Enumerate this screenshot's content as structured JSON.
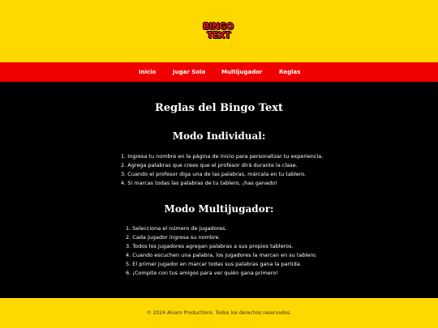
{
  "header": {
    "logo_line1": "BINGO",
    "logo_line2": "TEXT"
  },
  "nav": {
    "items": [
      {
        "label": "Inicio"
      },
      {
        "label": "Jugar Solo"
      },
      {
        "label": "Multijugador"
      },
      {
        "label": "Reglas"
      }
    ]
  },
  "main": {
    "title": "Reglas del Bingo Text",
    "individual": {
      "title": "Modo Individual:",
      "rules": [
        "Ingresa tu nombre en la página de inicio para personalizar tu experiencia.",
        "Agrega palabras que crees que el profesor dirá durante la clase.",
        "Cuando el profesor diga una de las palabras, márcala en tu tablero.",
        "Si marcas todas las palabras de tu tablero, ¡has ganado!"
      ]
    },
    "multiplayer": {
      "title": "Modo Multijugador:",
      "rules": [
        "Selecciona el número de jugadores.",
        "Cada jugador ingresa su nombre.",
        "Todos los jugadores agregan palabras a sus propios tableros.",
        "Cuando escuchen una palabra, los jugadores la marcan en su tablero.",
        "El primer jugador en marcar todas sus palabras gana la partida.",
        "¡Compite con tus amigos para ver quién gana primero!"
      ]
    }
  },
  "footer": {
    "text": "© 2024 Alvaro Productions. Todos los derechos reservados."
  },
  "colors": {
    "header_bg": "#FFD800",
    "nav_bg": "#F00000",
    "main_bg": "#000000",
    "logo_red": "#E8131B"
  }
}
